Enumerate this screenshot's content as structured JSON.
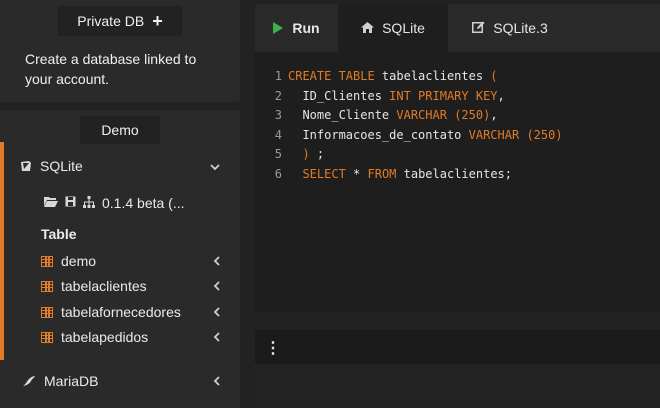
{
  "sidebar": {
    "private_tab": {
      "label": "Private DB",
      "icon": "plus-icon"
    },
    "private_description": "Create a database linked to your account.",
    "demo_tab": {
      "label": "Demo"
    },
    "sqlite": {
      "label": "SQLite",
      "icon": "database-icon",
      "expanded": true
    },
    "version": {
      "label": "0.1.4 beta (...",
      "icons": [
        "folder-open-icon",
        "save-icon",
        "sitemap-icon"
      ]
    },
    "table_heading": "Table",
    "tables": [
      {
        "label": "demo"
      },
      {
        "label": "tabelaclientes"
      },
      {
        "label": "tabelafornecedores"
      },
      {
        "label": "tabelapedidos"
      }
    ],
    "mariadb": {
      "label": "MariaDB",
      "icon": "seal-icon"
    }
  },
  "toolbar": {
    "run_label": "Run",
    "tabs": [
      {
        "label": "SQLite",
        "icon": "home-icon",
        "active": true
      },
      {
        "label": "SQLite.3",
        "icon": "edit-icon",
        "active": false
      }
    ]
  },
  "editor": {
    "lines": [
      {
        "n": "1",
        "tokens": [
          [
            "kw",
            "CREATE TABLE"
          ],
          [
            "tx",
            " tabelaclientes "
          ],
          [
            "kw",
            "("
          ]
        ]
      },
      {
        "n": "2",
        "tokens": [
          [
            "tx",
            "  ID_Clientes "
          ],
          [
            "kw",
            "INT PRIMARY KEY"
          ],
          [
            "tx",
            ","
          ]
        ]
      },
      {
        "n": "3",
        "tokens": [
          [
            "tx",
            "  Nome_Cliente "
          ],
          [
            "kw",
            "VARCHAR"
          ],
          [
            "tx",
            " "
          ],
          [
            "kw",
            "(250)"
          ],
          [
            "tx",
            ","
          ]
        ]
      },
      {
        "n": "4",
        "tokens": [
          [
            "tx",
            "  Informacoes_de_contato "
          ],
          [
            "kw",
            "VARCHAR"
          ],
          [
            "tx",
            " "
          ],
          [
            "kw",
            "(250)"
          ]
        ]
      },
      {
        "n": "5",
        "tokens": [
          [
            "kw",
            "  )"
          ],
          [
            "tx",
            " ;"
          ]
        ]
      },
      {
        "n": "6",
        "tokens": [
          [
            "tx",
            "  "
          ],
          [
            "kw",
            "SELECT"
          ],
          [
            "tx",
            " * "
          ],
          [
            "kw",
            "FROM"
          ],
          [
            "tx",
            " tabelaclientes;"
          ]
        ]
      }
    ]
  },
  "colors": {
    "accent": "#e07b26",
    "run": "#3fb04a",
    "background": "#222222",
    "panel": "#2a2a2a",
    "editor": "#1e1e1e"
  }
}
